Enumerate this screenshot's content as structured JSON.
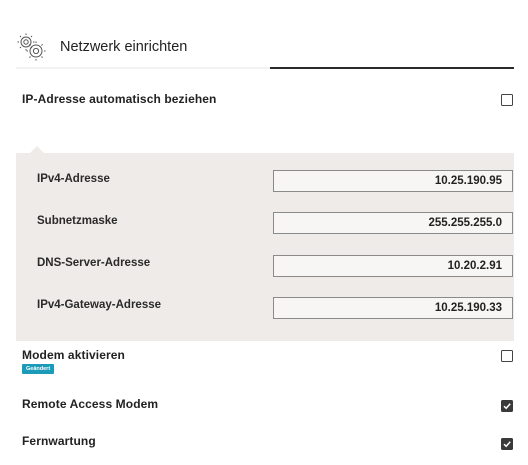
{
  "header": {
    "title": "Netzwerk einrichten",
    "icon": "gears-icon"
  },
  "auto_ip": {
    "label": "IP-Adresse automatisch beziehen",
    "checked": false
  },
  "fields": {
    "ipv4": {
      "label": "IPv4-Adresse",
      "value": "10.25.190.95"
    },
    "subnet": {
      "label": "Subnetzmaske",
      "value": "255.255.255.0"
    },
    "dns": {
      "label": "DNS-Server-Adresse",
      "value": "10.20.2.91"
    },
    "gateway": {
      "label": "IPv4-Gateway-Adresse",
      "value": "10.25.190.33"
    }
  },
  "modem": {
    "label": "Modem aktivieren",
    "badge": "Geändert",
    "checked": false
  },
  "remote_access": {
    "label": "Remote Access Modem",
    "checked": true
  },
  "fernwartung": {
    "label": "Fernwartung",
    "checked": true
  },
  "colors": {
    "badge": "#1b9bb8",
    "panel": "#efebe8",
    "header_line": "#2b2b2b"
  }
}
